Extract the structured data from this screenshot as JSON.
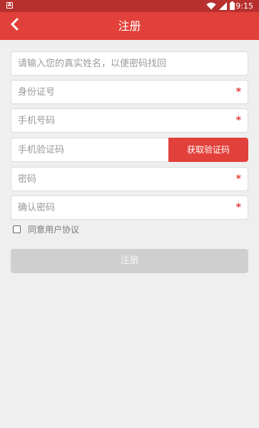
{
  "status_bar": {
    "notification_icon": "a-notification-icon",
    "time": "9:15",
    "icons": [
      "wifi-icon",
      "signal-icon",
      "battery-icon"
    ]
  },
  "app_bar": {
    "back_icon": "chevron-left-icon",
    "title": "注册",
    "background_color": "#e2403a"
  },
  "form": {
    "name_placeholder": "请输入您的真实姓名，以便密码找回",
    "id_placeholder": "身份证号",
    "phone_placeholder": "手机号码",
    "code_placeholder": "手机验证码",
    "get_code_label": "获取验证码",
    "password_placeholder": "密码",
    "confirm_placeholder": "确认密码",
    "required_mark": "*",
    "agree_label": "同意用户协议",
    "submit_label": "注册"
  },
  "colors": {
    "accent": "#e2403a",
    "status_bar": "#b7302e",
    "disabled_button": "#cfcfcf"
  }
}
